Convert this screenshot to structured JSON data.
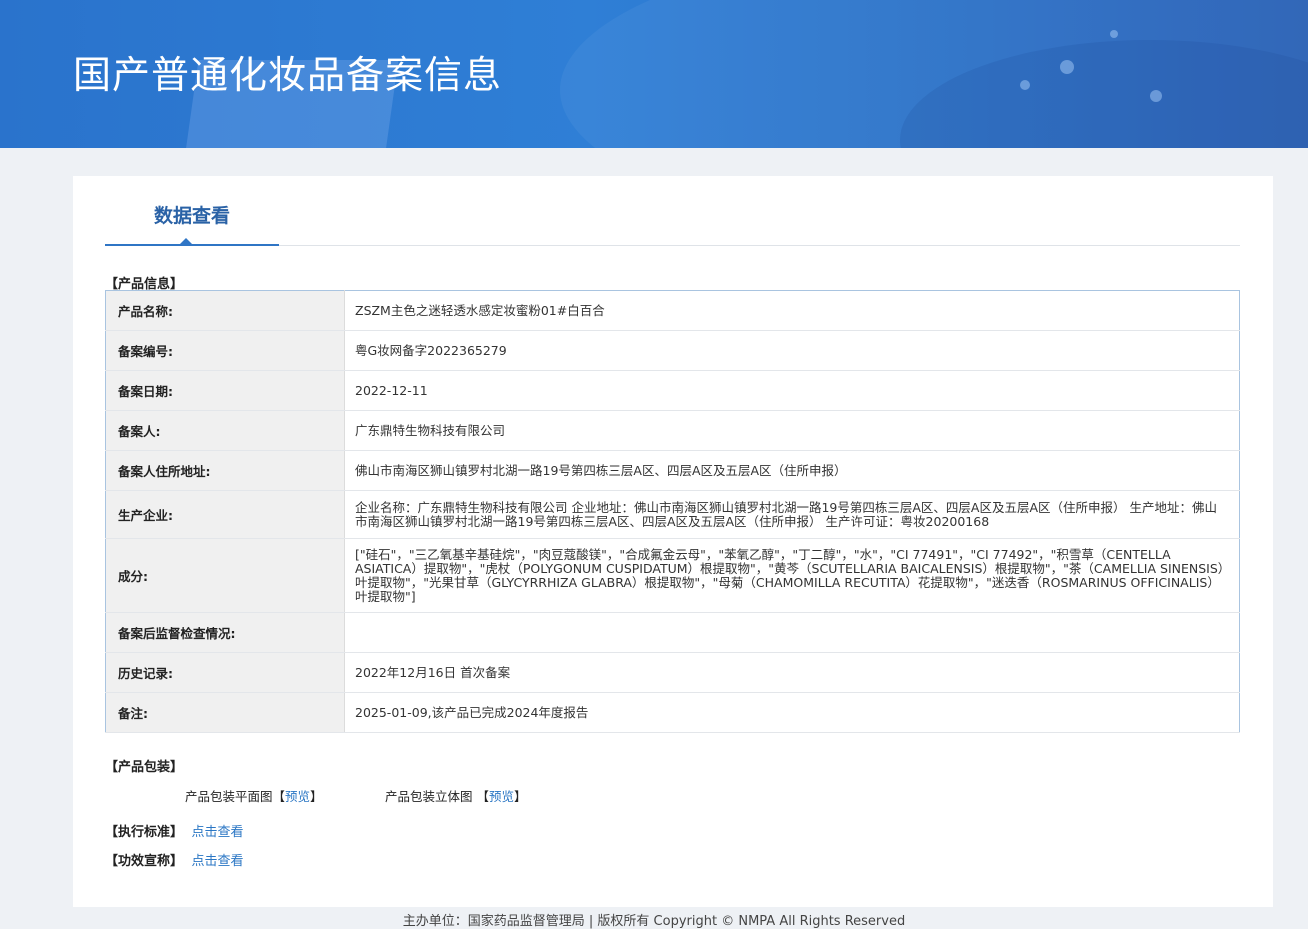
{
  "header": {
    "title": "国产普通化妆品备案信息"
  },
  "tab": {
    "label": "数据查看"
  },
  "sections": {
    "product_info": "【产品信息】",
    "product_package": "【产品包装】",
    "standard": "【执行标准】",
    "efficacy": "【功效宣称】"
  },
  "info_rows": [
    {
      "key": "产品名称:",
      "value": "ZSZM主色之迷轻透水感定妆蜜粉01#白百合"
    },
    {
      "key": "备案编号:",
      "value": "粤G妆网备字2022365279"
    },
    {
      "key": "备案日期:",
      "value": "2022-12-11"
    },
    {
      "key": "备案人:",
      "value": "广东鼎特生物科技有限公司"
    },
    {
      "key": "备案人住所地址:",
      "value": "佛山市南海区狮山镇罗村北湖一路19号第四栋三层A区、四层A区及五层A区（住所申报）"
    },
    {
      "key": "生产企业:",
      "value": "企业名称：广东鼎特生物科技有限公司 企业地址：佛山市南海区狮山镇罗村北湖一路19号第四栋三层A区、四层A区及五层A区（住所申报） 生产地址：佛山市南海区狮山镇罗村北湖一路19号第四栋三层A区、四层A区及五层A区（住所申报） 生产许可证：粤妆20200168"
    },
    {
      "key": "成分:",
      "value": "[\"硅石\"，\"三乙氧基辛基硅烷\"，\"肉豆蔻酸镁\"，\"合成氟金云母\"，\"苯氧乙醇\"，\"丁二醇\"，\"水\"，\"CI 77491\"，\"CI 77492\"，\"积雪草（CENTELLA ASIATICA）提取物\"，\"虎杖（POLYGONUM CUSPIDATUM）根提取物\"，\"黄芩（SCUTELLARIA BAICALENSIS）根提取物\"，\"茶（CAMELLIA SINENSIS）叶提取物\"，\"光果甘草（GLYCYRRHIZA GLABRA）根提取物\"，\"母菊（CHAMOMILLA RECUTITA）花提取物\"，\"迷迭香（ROSMARINUS OFFICINALIS）叶提取物\"]"
    },
    {
      "key": "备案后监督检查情况:",
      "value": ""
    },
    {
      "key": "历史记录:",
      "value": "2022年12月16日 首次备案"
    },
    {
      "key": "备注:",
      "value": "2025-01-09,该产品已完成2024年度报告"
    }
  ],
  "package": {
    "flat_label": "产品包装平面图",
    "solid_label": "产品包装立体图",
    "preview_link": "预览",
    "bracket_open": "【",
    "bracket_close": "】"
  },
  "links": {
    "view": "点击查看"
  },
  "footer": {
    "text": "主办单位：国家药品监督管理局 | 版权所有 Copyright © NMPA All Rights Reserved"
  }
}
